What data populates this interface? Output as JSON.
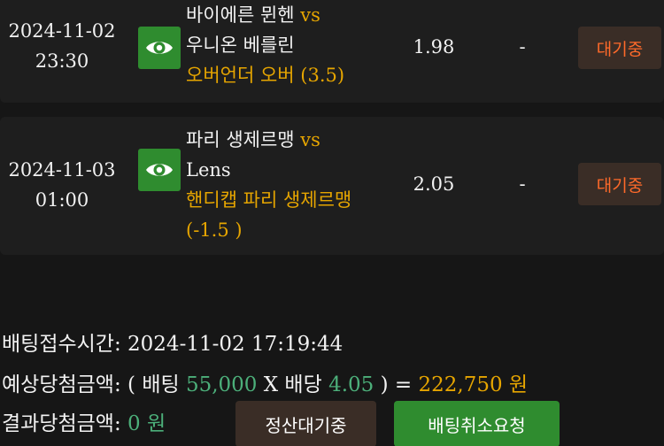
{
  "bets": [
    {
      "date": "2024-11-02",
      "time": "23:30",
      "home": "바이에른 뮌헨",
      "vs": "vs",
      "away": "우니온 베를린",
      "selection_line1": "오버언더 오버 (3.5)",
      "selection_line2": "",
      "odds": "1.98",
      "result": "-",
      "status": "대기중",
      "icon": "eye-icon"
    },
    {
      "date": "2024-11-03",
      "time": "01:00",
      "home": "파리 생제르맹",
      "vs": "vs",
      "away": "Lens",
      "selection_line1": "핸디캡 파리 생제르맹",
      "selection_line2": "(-1.5 )",
      "odds": "2.05",
      "result": "-",
      "status": "대기중",
      "icon": "eye-icon"
    }
  ],
  "summary": {
    "bet_time_label": "배팅접수시간:",
    "bet_time_value": "2024-11-02 17:19:44",
    "expected_label": "예상당첨금액:",
    "open_paren": "( 배팅",
    "stake": "55,000",
    "times": "X 배당",
    "total_odds": "4.05",
    "close_paren": ") =",
    "expected_amount": "222,750",
    "won": "원",
    "result_label": "결과당첨금액:",
    "result_amount": "0",
    "result_won": "원"
  },
  "buttons": {
    "pending_label": "정산대기중",
    "cancel_label": "배팅취소요청"
  },
  "colors": {
    "accent_gold": "#e6a500",
    "accent_green": "#2f8c2f",
    "status_orange": "#ff6a2a"
  }
}
